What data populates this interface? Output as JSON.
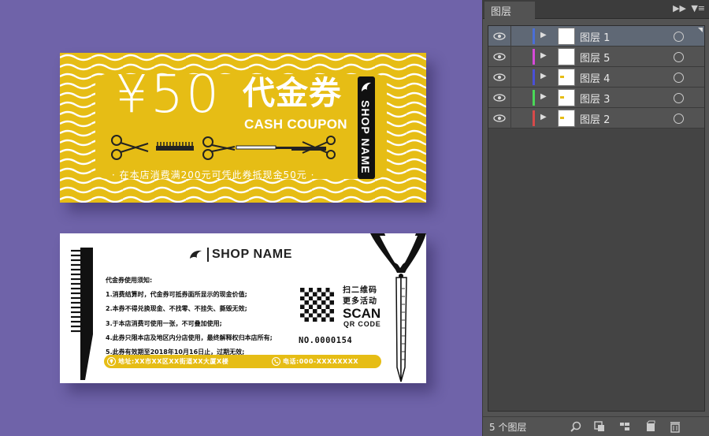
{
  "colors": {
    "background": "#6f63a9",
    "coupon_yellow": "#e6bd15",
    "panel": "#535353"
  },
  "coupon_front": {
    "price": "¥50",
    "title": "代金券",
    "subtitle": "CASH COUPON",
    "shop_name": "SHOP NAME",
    "offer": "· 在本店消费满200元可凭此券抵现金50元 ·"
  },
  "coupon_back": {
    "shop_name": "SHOP NAME",
    "notice_title": "代金券使用须知:",
    "notice_items": [
      "1.消费结算时，代金券可抵券面所显示的现金价值;",
      "2.本券不得兑换现金、不找零、不挂失、撕毁无效;",
      "3.于本店消费可使用一张，不可叠加使用;",
      "4.此券只限本店及地区内分店使用，最终解释权归本店所有;",
      "5.此券有效期至2018年10月16日止，过期无效;"
    ],
    "scan_zh_line1": "扫二维码",
    "scan_zh_line2": "更多活动",
    "scan_en": "SCAN",
    "qr_label": "QR CODE",
    "serial": "NO.0000154",
    "address": "地址:XX市XX区XX街道XX大厦X楼",
    "phone": "电话:000-XXXXXXXX"
  },
  "layers_panel": {
    "tab_label": "图层",
    "collapse_icon": "double-chevron-right-icon",
    "menu_icon": "panel-menu-icon",
    "layers": [
      {
        "name": "图层 1",
        "color": "#4a6fd8",
        "selected": true
      },
      {
        "name": "图层 5",
        "color": "#d64ad8",
        "selected": false
      },
      {
        "name": "图层 4",
        "color": "#4a50d8",
        "selected": false
      },
      {
        "name": "图层 3",
        "color": "#4ad858",
        "selected": false
      },
      {
        "name": "图层 2",
        "color": "#d84a4a",
        "selected": false
      }
    ],
    "footer_count": "5 个图层",
    "footer_icons": [
      "locate-object-icon",
      "clipping-mask-icon",
      "new-sublayer-icon",
      "new-layer-icon",
      "delete-icon"
    ]
  }
}
